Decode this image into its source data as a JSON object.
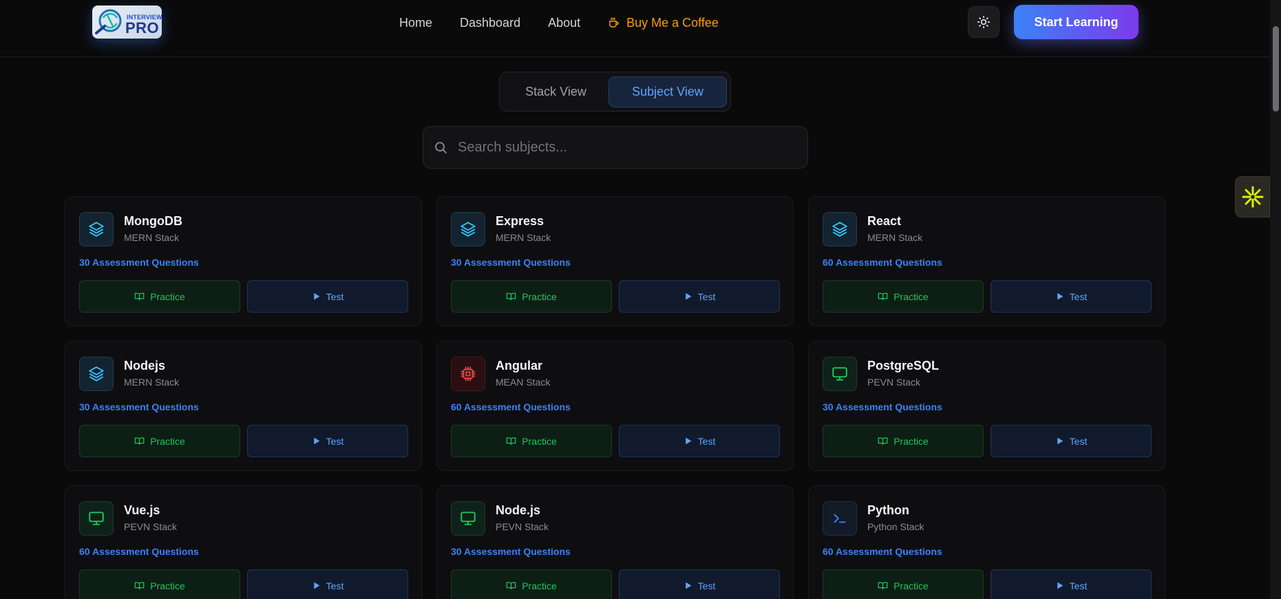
{
  "header": {
    "logo": {
      "top_text": "INTERVIEW",
      "main_text": "PRO"
    },
    "nav": [
      {
        "label": "Home"
      },
      {
        "label": "Dashboard"
      },
      {
        "label": "About"
      }
    ],
    "coffee_label": "Buy Me a Coffee",
    "start_label": "Start Learning"
  },
  "view_toggle": {
    "stack_label": "Stack View",
    "subject_label": "Subject View",
    "active": "Subject View"
  },
  "search": {
    "placeholder": "Search subjects...",
    "value": ""
  },
  "colors": {
    "accent_blue": "#3b82f6",
    "practice_green": "#22c55e",
    "coffee": "#f59e0b"
  },
  "cards": [
    {
      "title": "MongoDB",
      "stack": "MERN Stack",
      "questions": "30 Assessment Questions",
      "icon": "layers-icon",
      "practice_label": "Practice",
      "test_label": "Test"
    },
    {
      "title": "Express",
      "stack": "MERN Stack",
      "questions": "30 Assessment Questions",
      "icon": "layers-icon",
      "practice_label": "Practice",
      "test_label": "Test"
    },
    {
      "title": "React",
      "stack": "MERN Stack",
      "questions": "60 Assessment Questions",
      "icon": "layers-icon",
      "practice_label": "Practice",
      "test_label": "Test"
    },
    {
      "title": "Nodejs",
      "stack": "MERN Stack",
      "questions": "30 Assessment Questions",
      "icon": "layers-icon",
      "practice_label": "Practice",
      "test_label": "Test"
    },
    {
      "title": "Angular",
      "stack": "MEAN Stack",
      "questions": "60 Assessment Questions",
      "icon": "cpu-icon",
      "practice_label": "Practice",
      "test_label": "Test"
    },
    {
      "title": "PostgreSQL",
      "stack": "PEVN Stack",
      "questions": "30 Assessment Questions",
      "icon": "monitor-icon",
      "practice_label": "Practice",
      "test_label": "Test"
    },
    {
      "title": "Vue.js",
      "stack": "PEVN Stack",
      "questions": "60 Assessment Questions",
      "icon": "monitor-icon",
      "practice_label": "Practice",
      "test_label": "Test"
    },
    {
      "title": "Node.js",
      "stack": "PEVN Stack",
      "questions": "30 Assessment Questions",
      "icon": "monitor-icon",
      "practice_label": "Practice",
      "test_label": "Test"
    },
    {
      "title": "Python",
      "stack": "Python Stack",
      "questions": "60 Assessment Questions",
      "icon": "terminal-icon",
      "practice_label": "Practice",
      "test_label": "Test"
    }
  ]
}
